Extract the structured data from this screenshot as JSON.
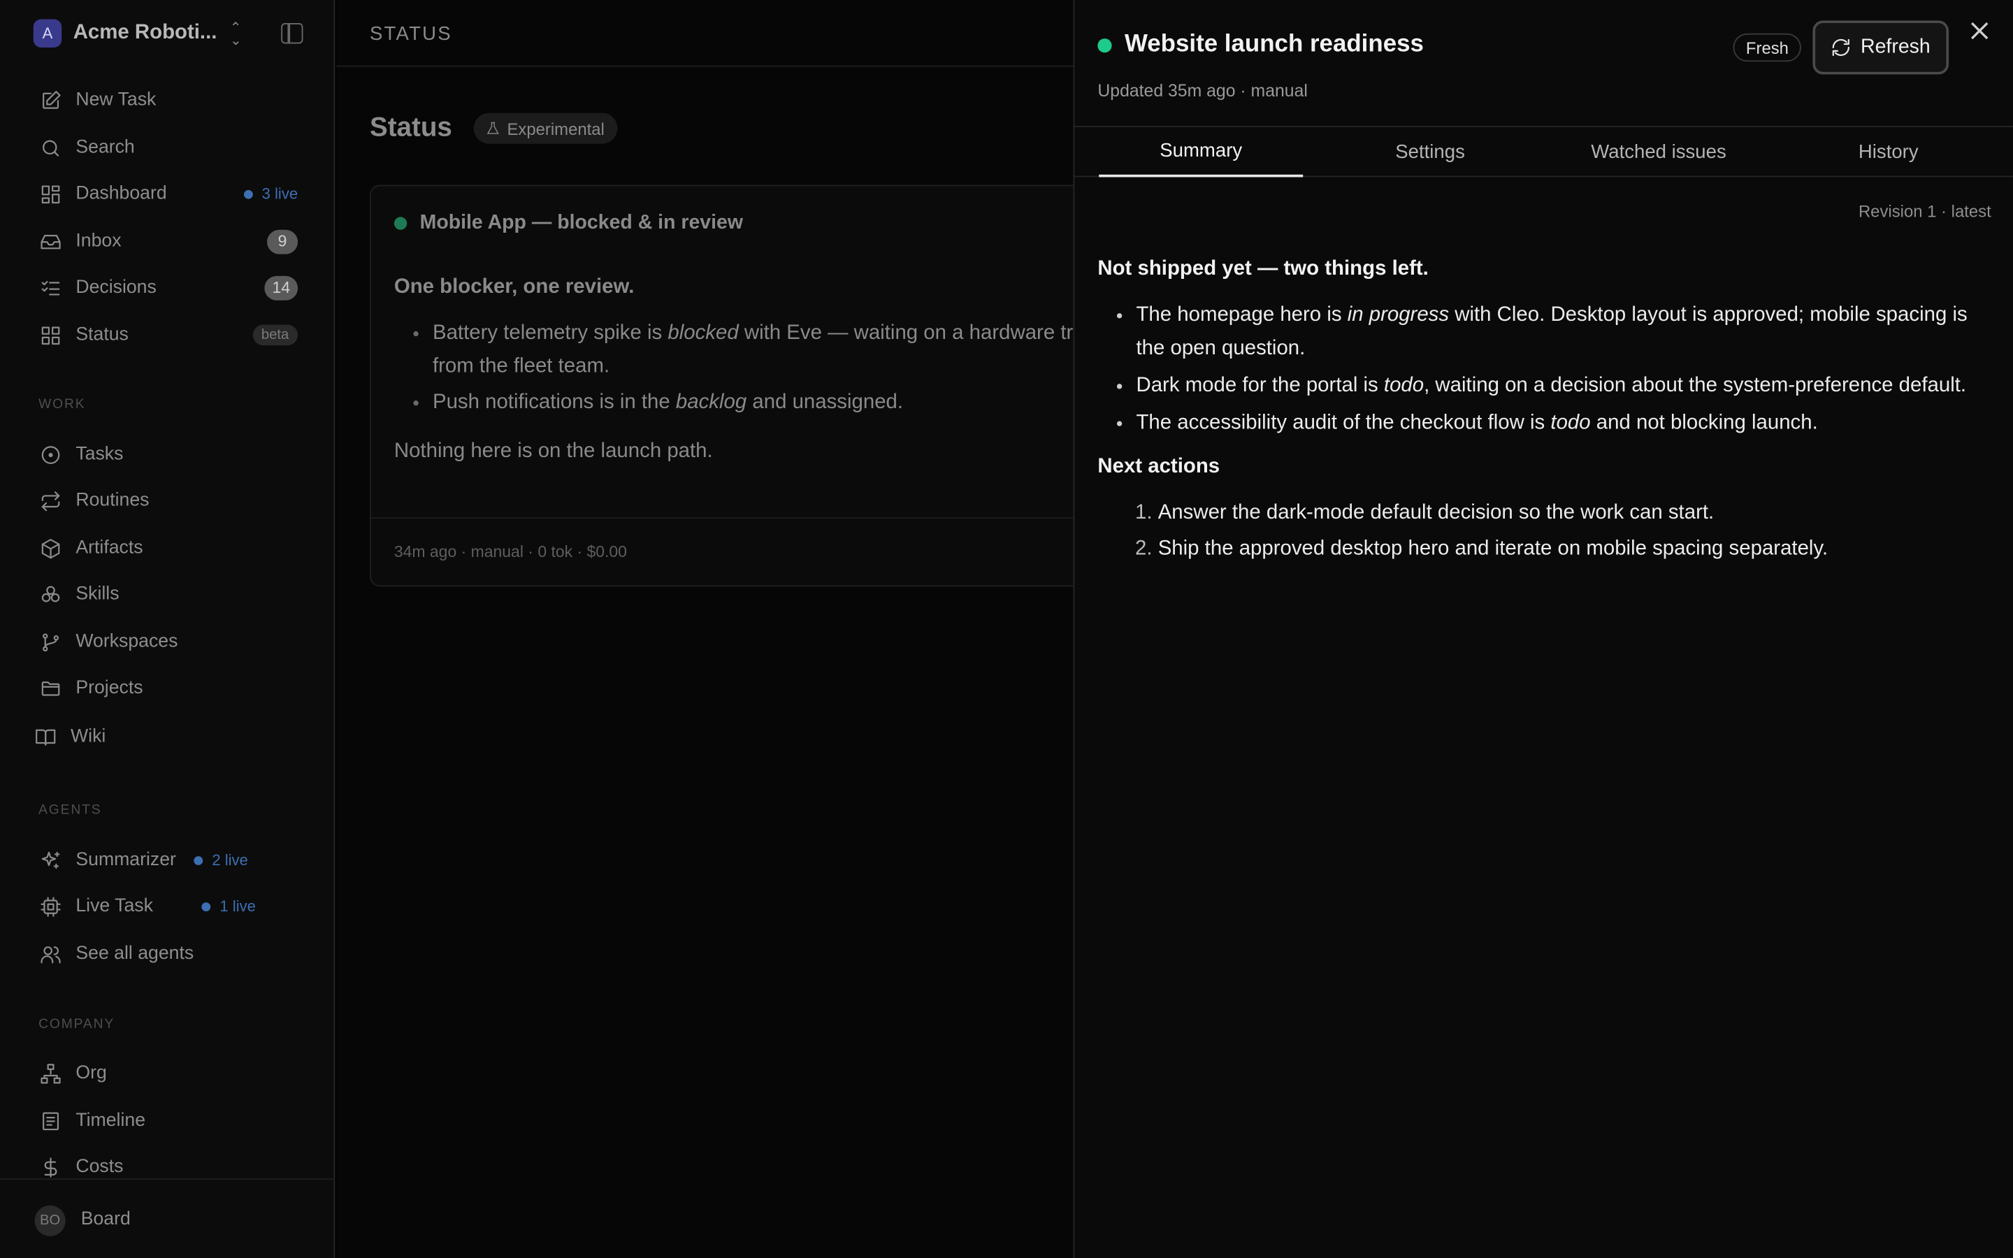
{
  "sidebar": {
    "workspace": {
      "initial": "A",
      "name": "Acme Roboti..."
    },
    "nav": [
      {
        "label": "New Task",
        "icon": "edit-icon"
      },
      {
        "label": "Search",
        "icon": "search-icon"
      },
      {
        "label": "Dashboard",
        "icon": "dashboard-icon",
        "live": "3 live"
      },
      {
        "label": "Inbox",
        "icon": "inbox-icon",
        "count": "9"
      },
      {
        "label": "Decisions",
        "icon": "checklist-icon",
        "count": "14"
      },
      {
        "label": "Status",
        "icon": "status-grid-icon",
        "badge": "beta"
      }
    ],
    "work_label": "WORK",
    "work": [
      {
        "label": "Tasks",
        "icon": "circle-dot-icon"
      },
      {
        "label": "Routines",
        "icon": "repeat-icon"
      },
      {
        "label": "Artifacts",
        "icon": "box-icon"
      },
      {
        "label": "Skills",
        "icon": "boxes-icon"
      },
      {
        "label": "Workspaces",
        "icon": "git-branch-icon"
      },
      {
        "label": "Projects",
        "icon": "folder-icon"
      },
      {
        "label": "Wiki",
        "icon": "book-icon"
      }
    ],
    "agents_label": "AGENTS",
    "agents": [
      {
        "label": "Summarizer",
        "icon": "sparkles-icon",
        "live": "2 live"
      },
      {
        "label": "Live Task",
        "icon": "cpu-icon",
        "live": "1 live"
      },
      {
        "label": "See all agents",
        "icon": "users-icon"
      }
    ],
    "company_label": "COMPANY",
    "company": [
      {
        "label": "Org",
        "icon": "org-chart-icon"
      },
      {
        "label": "Timeline",
        "icon": "timeline-icon"
      },
      {
        "label": "Costs",
        "icon": "dollar-icon"
      }
    ],
    "footer": {
      "avatar": "BO",
      "label": "Board"
    }
  },
  "main": {
    "header_title": "STATUS",
    "page_title": "Status",
    "badge": "Experimental",
    "card": {
      "title": "Mobile App — blocked & in review",
      "lead": "One blocker, one review.",
      "closing": "Nothing here is on the launch path.",
      "meta": "34m ago · manual · 0 tok · $0.00"
    }
  },
  "panel": {
    "title": "Website launch readiness",
    "subtitle": "Updated 35m ago · manual",
    "fresh": "Fresh",
    "refresh": "Refresh",
    "tabs": [
      "Summary",
      "Settings",
      "Watched issues",
      "History"
    ],
    "revision": "Revision 1 · latest",
    "heading": "Not shipped yet — two things left.",
    "next_heading": "Next actions",
    "next_actions": [
      "Answer the dark-mode default decision so the work can start.",
      "Ship the approved desktop hero and iterate on mobile spacing separately."
    ]
  },
  "colors": {
    "accent_live": "#3d6fb3",
    "status_green": "#1ecb8a",
    "panel_bg": "#0a0a0a"
  }
}
